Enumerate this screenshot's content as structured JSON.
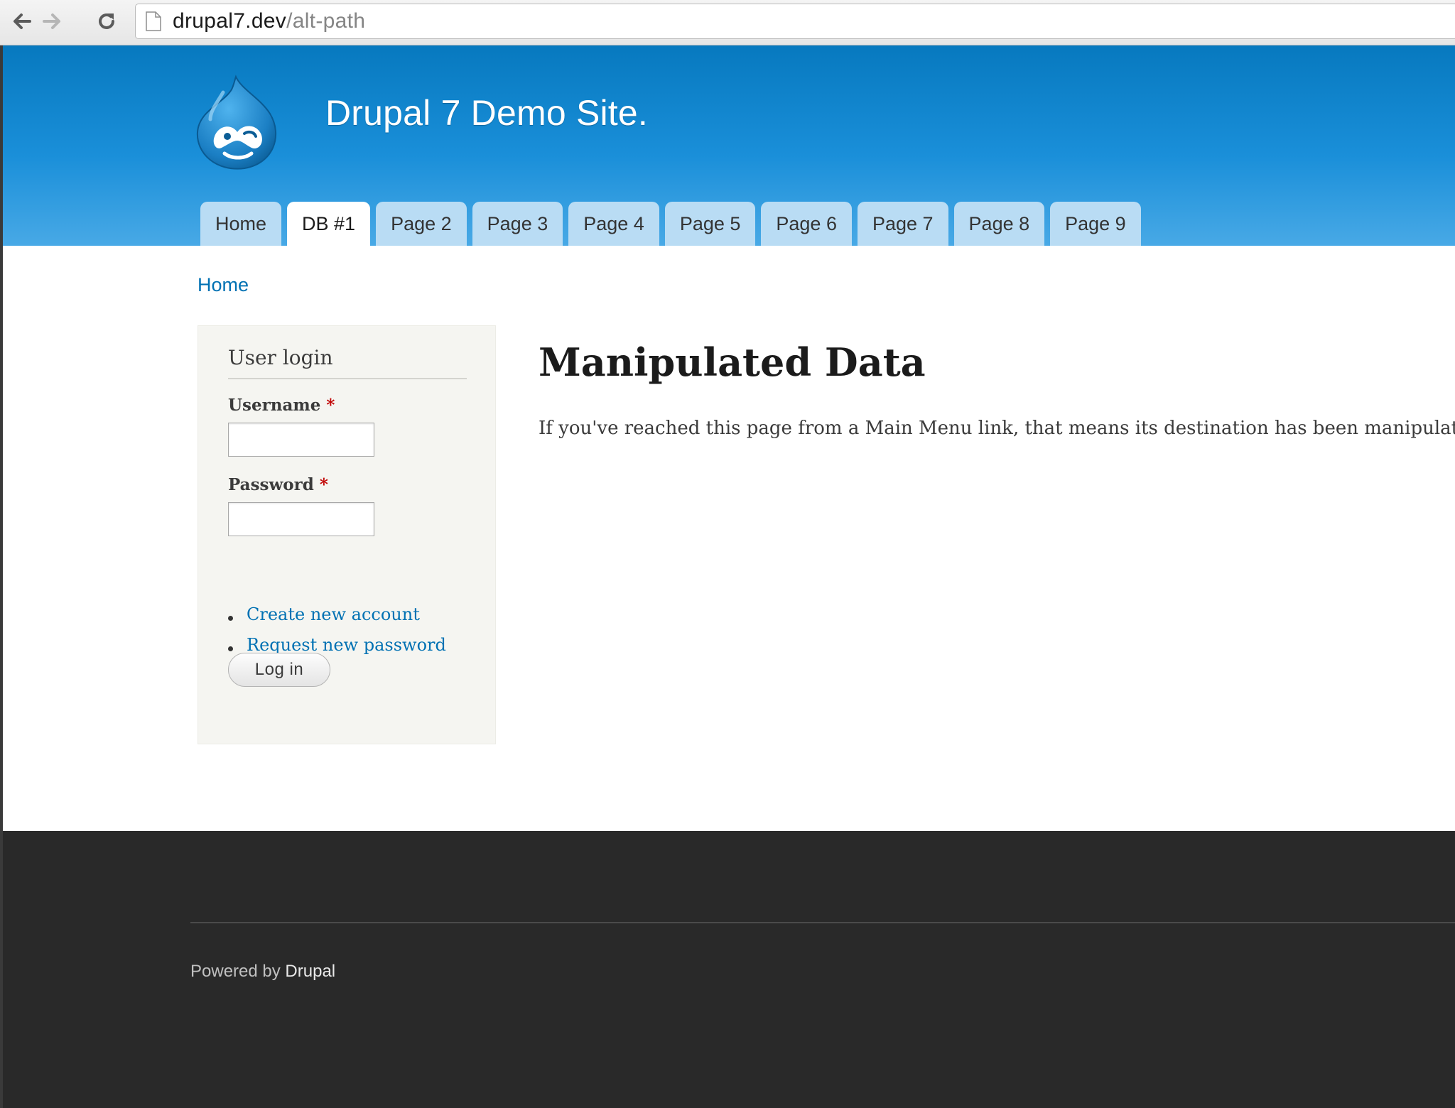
{
  "browser": {
    "url_host": "drupal7.dev",
    "url_path": "/alt-path",
    "icons": [
      "back-arrow-icon",
      "forward-arrow-icon",
      "reload-icon",
      "page-icon"
    ]
  },
  "header": {
    "site_name": "Drupal 7 Demo Site.",
    "logo": "drupal-drop-logo",
    "colors": {
      "gradient_top": "#0779bf",
      "gradient_bottom": "#48a9e6",
      "tab": "#b9dcf4"
    }
  },
  "main_menu": {
    "tabs": [
      {
        "label": "Home"
      },
      {
        "label": "DB #1",
        "active": true
      },
      {
        "label": "Page 2"
      },
      {
        "label": "Page 3"
      },
      {
        "label": "Page 4"
      },
      {
        "label": "Page 5"
      },
      {
        "label": "Page 6"
      },
      {
        "label": "Page 7"
      },
      {
        "label": "Page 8"
      },
      {
        "label": "Page 9"
      }
    ]
  },
  "breadcrumb": {
    "home": "Home"
  },
  "login_block": {
    "title": "User login",
    "username_label": "Username",
    "password_label": "Password",
    "required_marker": "*",
    "username_value": "",
    "password_value": "",
    "create_account": "Create new account",
    "request_password": "Request new password",
    "submit": "Log in"
  },
  "content": {
    "title": "Manipulated Data",
    "body": "If you've reached this page from a Main Menu link, that means its destination has been manipulat"
  },
  "footer": {
    "powered_prefix": "Powered by",
    "powered_link": "Drupal"
  }
}
